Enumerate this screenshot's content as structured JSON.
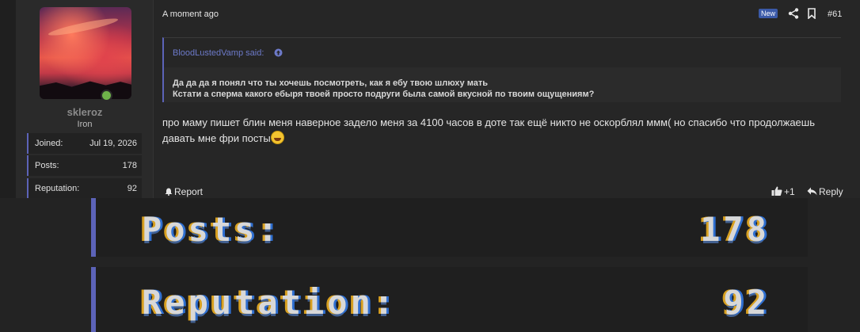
{
  "user": {
    "name": "skleroz",
    "title": "Iron",
    "stats": [
      {
        "label": "Joined:",
        "value": "Jul 19, 2026"
      },
      {
        "label": "Posts:",
        "value": "178"
      },
      {
        "label": "Reputation:",
        "value": "92"
      }
    ]
  },
  "post": {
    "time": "A moment ago",
    "badge": "New",
    "number": "#61",
    "quote": {
      "author": "BloodLustedVamp said:",
      "lines": [
        "Да да да я понял что ты хочешь посмотреть, как я ебу твою шлюху мать",
        "Кстати а сперма какого ебыря твоей просто подруги была самой вкусной по твоим ощущениям?"
      ]
    },
    "message_line1": "про маму пишет блин меня наверное задело меня за 4100 часов в доте так ещё никто не оскорблял ммм( но спасибо что продолжаешь",
    "message_line2": "давать мне фри посты",
    "actions": {
      "report": "Report",
      "like_count": "+1",
      "reply": "Reply"
    }
  },
  "zoom": {
    "rows": [
      {
        "label": "Posts:",
        "value": "178"
      },
      {
        "label": "Reputation:",
        "value": "92"
      }
    ]
  },
  "colors": {
    "accent": "#5c63b8",
    "online": "#6fb34a",
    "badge": "#3b5aa8",
    "quote_author": "#6d7ac9"
  }
}
